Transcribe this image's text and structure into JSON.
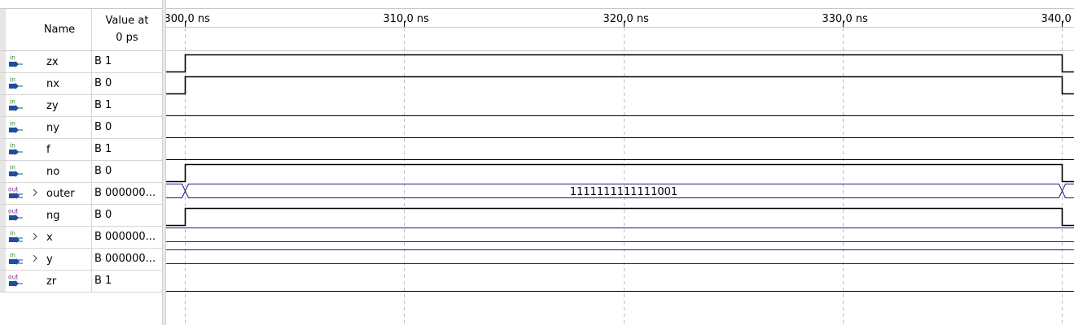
{
  "columns": {
    "name_header": "Name",
    "value_header": [
      "Value at",
      "0 ps"
    ]
  },
  "timeline": {
    "ticks": [
      {
        "label": "300,0 ns",
        "ns": 300
      },
      {
        "label": "310,0 ns",
        "ns": 310
      },
      {
        "label": "320,0 ns",
        "ns": 320
      },
      {
        "label": "330,0 ns",
        "ns": 330
      },
      {
        "label": "340,0",
        "ns": 340
      }
    ],
    "view_start_ns": 299.14,
    "view_end_ns": 340.55,
    "edge_rise_ns": 300,
    "edge_fall_ns": 340
  },
  "signals": [
    {
      "name": "zx",
      "dir": "in",
      "expandable": false,
      "value": "B 1",
      "kind": "pulse"
    },
    {
      "name": "nx",
      "dir": "in",
      "expandable": false,
      "value": "B 0",
      "kind": "pulse"
    },
    {
      "name": "zy",
      "dir": "in",
      "expandable": false,
      "value": "B 1",
      "kind": "low"
    },
    {
      "name": "ny",
      "dir": "in",
      "expandable": false,
      "value": "B 0",
      "kind": "low"
    },
    {
      "name": "f",
      "dir": "in",
      "expandable": false,
      "value": "B 1",
      "kind": "low"
    },
    {
      "name": "no",
      "dir": "in",
      "expandable": false,
      "value": "B 0",
      "kind": "pulse"
    },
    {
      "name": "outer",
      "dir": "out",
      "expandable": true,
      "value": "B 000000...",
      "kind": "bus",
      "bus_value": "1111111111111001"
    },
    {
      "name": "ng",
      "dir": "out",
      "expandable": false,
      "value": "B 0",
      "kind": "pulse"
    },
    {
      "name": "x",
      "dir": "in",
      "expandable": true,
      "value": "B 000000...",
      "kind": "bus",
      "bus_value": ""
    },
    {
      "name": "y",
      "dir": "in",
      "expandable": true,
      "value": "B 000000...",
      "kind": "bus",
      "bus_value": ""
    },
    {
      "name": "zr",
      "dir": "out",
      "expandable": false,
      "value": "B 1",
      "kind": "low"
    }
  ],
  "icons": {
    "in": "input-port-icon",
    "out": "output-port-icon",
    "bus_in": "input-bus-icon",
    "bus_out": "output-bus-icon"
  },
  "colors": {
    "wave": "#000000",
    "bus": "#1a1a8c",
    "grid": "#bdbdbd",
    "icon_blue": "#1f4e9c",
    "icon_green": "#2f7d32",
    "icon_out": "#7b2d8b"
  }
}
